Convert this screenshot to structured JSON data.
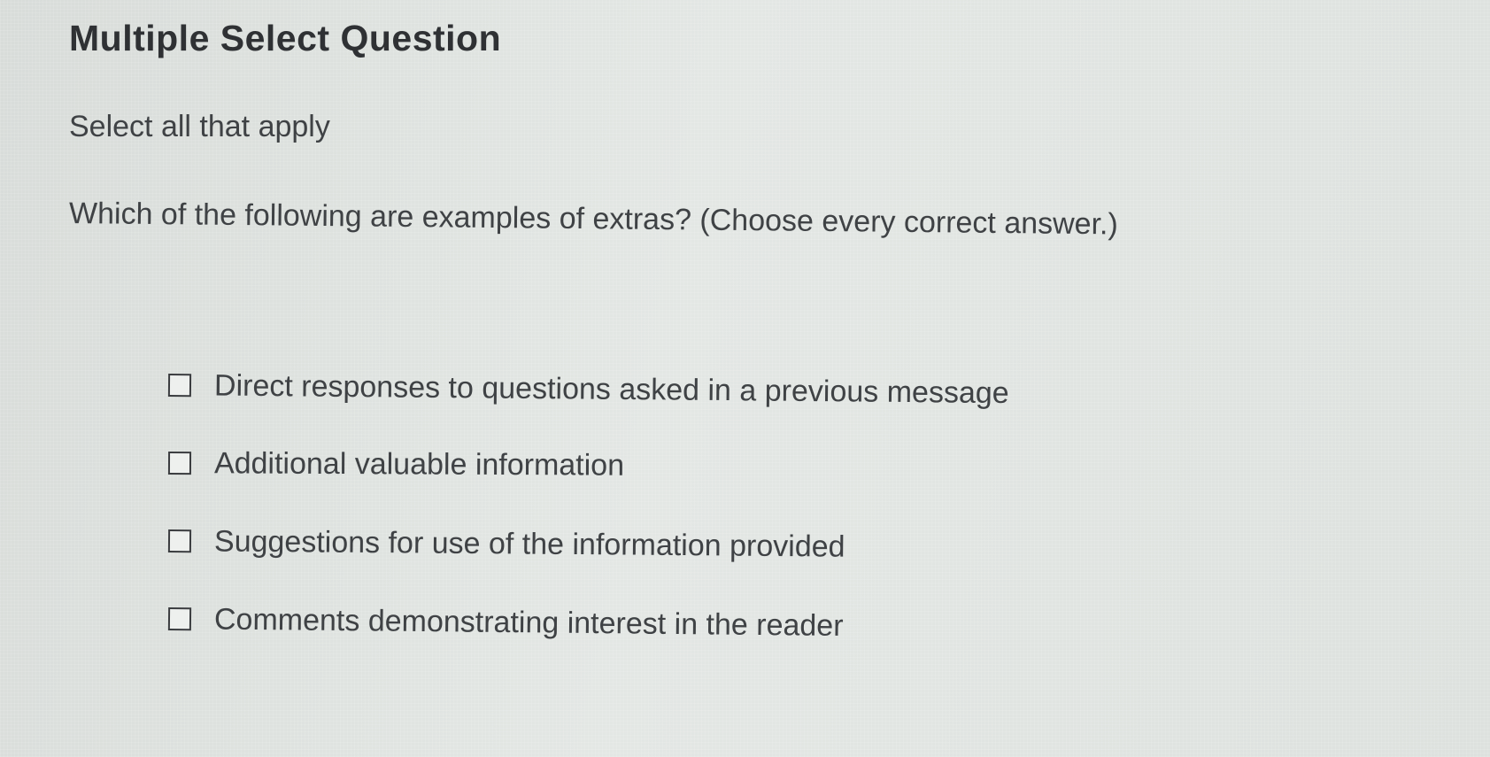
{
  "question": {
    "title": "Multiple Select Question",
    "instruction": "Select all that apply",
    "prompt": "Which of the following are examples of extras? (Choose every correct answer.)",
    "options": [
      {
        "label": "Direct responses to questions asked in a previous message",
        "checked": false
      },
      {
        "label": "Additional valuable information",
        "checked": false
      },
      {
        "label": "Suggestions for use of the information provided",
        "checked": false
      },
      {
        "label": "Comments demonstrating interest in the reader",
        "checked": false
      }
    ]
  },
  "colors": {
    "background": "#dfe3e0",
    "text": "#3f4245",
    "checkbox_border": "#3a3c3f"
  },
  "icons": {
    "checkbox": "checkbox-unchecked-icon"
  }
}
